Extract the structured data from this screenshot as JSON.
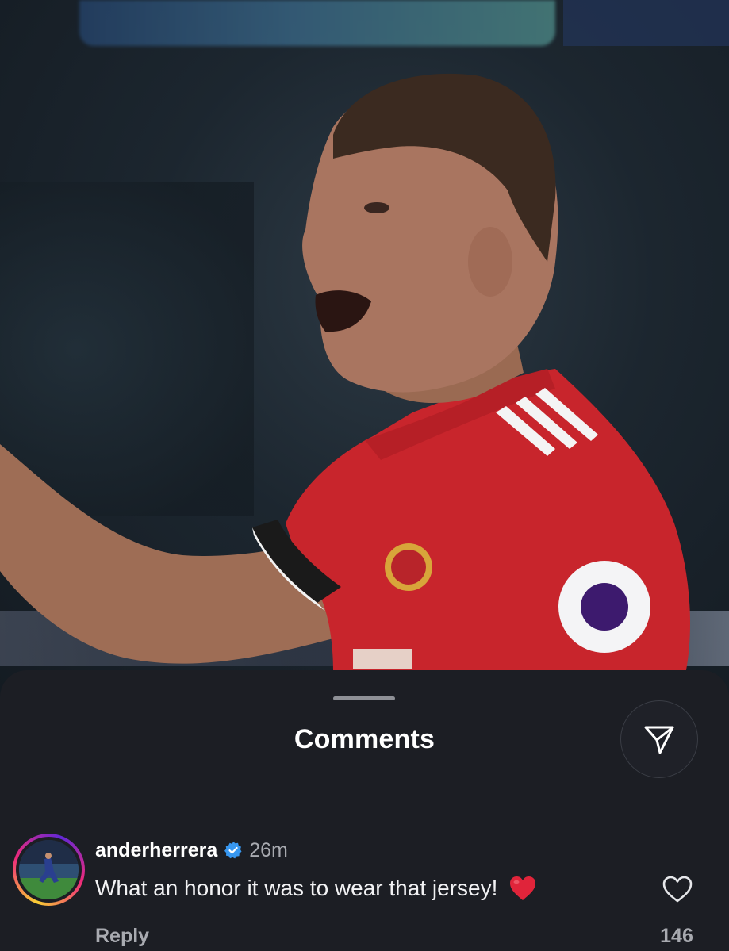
{
  "sheet": {
    "title": "Comments",
    "share_icon": "send-icon"
  },
  "comment": {
    "username": "anderherrera",
    "verified": true,
    "time": "26m",
    "text": "What an honor it was to wear that jersey!",
    "emoji": "red-heart",
    "reply_label": "Reply",
    "likes": "146",
    "like_icon": "heart-outline-icon"
  },
  "colors": {
    "sheet_bg": "#1c1e24",
    "verified_blue": "#3797f0",
    "heart_red": "#e0243a",
    "muted_text": "#a8aab0",
    "jersey_red": "#c8252c"
  }
}
